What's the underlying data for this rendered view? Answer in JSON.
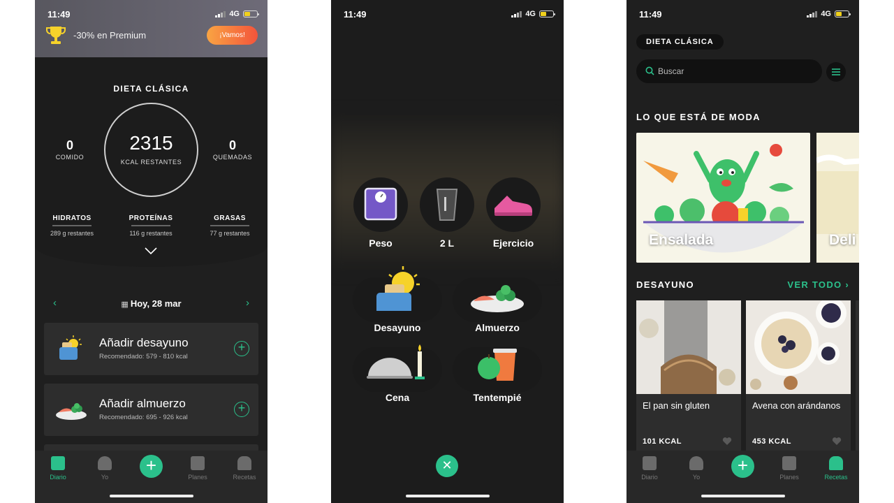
{
  "status": {
    "time": "11:49",
    "network": "4G"
  },
  "screen1": {
    "promo": {
      "text": "-30% en Premium",
      "button": "¡Vamos!"
    },
    "diet_title": "DIETA CLÁSICA",
    "ring": {
      "value": "2315",
      "label": "KCAL RESTANTES"
    },
    "eaten": {
      "value": "0",
      "label": "COMIDO"
    },
    "burned": {
      "value": "0",
      "label": "QUEMADAS"
    },
    "macros": [
      {
        "name": "HIDRATOS",
        "remaining": "289 g restantes"
      },
      {
        "name": "PROTEÍNAS",
        "remaining": "116 g restantes"
      },
      {
        "name": "GRASAS",
        "remaining": "77 g restantes"
      }
    ],
    "date": "Hoy, 28 mar",
    "meals": [
      {
        "title": "Añadir desayuno",
        "subtitle": "Recomendado: 579 - 810  kcal"
      },
      {
        "title": "Añadir almuerzo",
        "subtitle": "Recomendado: 695 - 926  kcal"
      }
    ],
    "tabs": [
      "Diario",
      "Yo",
      "Planes",
      "Recetas"
    ]
  },
  "screen2": {
    "circles": [
      "Peso",
      "2 L",
      "Ejercicio"
    ],
    "meals": [
      "Desayuno",
      "Almuerzo",
      "Cena",
      "Tentempié"
    ]
  },
  "screen3": {
    "diet_tag": "DIETA CLÁSICA",
    "search_placeholder": "Buscar",
    "trending_title": "LO QUE ESTÁ DE MODA",
    "trending": [
      "Ensalada",
      "Deli"
    ],
    "breakfast_title": "DESAYUNO",
    "see_all": "VER TODO",
    "recipes": [
      {
        "name": "El pan sin gluten",
        "kcal": "101 KCAL"
      },
      {
        "name": "Avena con arándanos",
        "kcal": "453 KCAL"
      }
    ],
    "tabs": [
      "Diario",
      "Yo",
      "Planes",
      "Recetas"
    ]
  },
  "colors": {
    "accent": "#2bc08b",
    "background": "#1f1f1f",
    "card": "#2d2d2d"
  }
}
